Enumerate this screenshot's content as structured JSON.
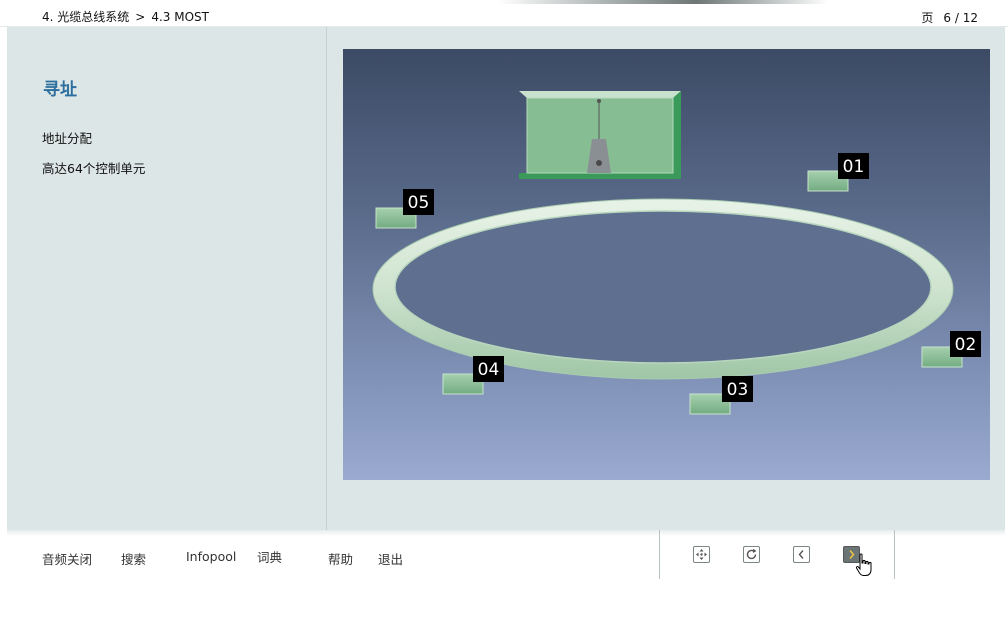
{
  "header": {
    "chapter": "4. 光缆总线系统",
    "separator": ">",
    "section": "4.3 MOST",
    "page_label": "页",
    "page_current": 6,
    "page_total": 12,
    "page_display": "6 / 12"
  },
  "sidebar": {
    "title": "寻址",
    "items": [
      "地址分配",
      "高达64个控制单元"
    ]
  },
  "diagram": {
    "nodes": [
      "01",
      "02",
      "03",
      "04",
      "05"
    ],
    "colors": {
      "ring": "#cfe3cf",
      "node_fill": "#88bd94",
      "label_bg": "#000000",
      "label_text": "#ffffff"
    }
  },
  "footer": {
    "menu": [
      "音频关闭",
      "搜索",
      "Infopool",
      "词典",
      "帮助",
      "退出"
    ],
    "nav_buttons": [
      "overview-icon",
      "reload-icon",
      "previous-icon",
      "next-icon"
    ]
  },
  "colors": {
    "title": "#2d6f9e",
    "panel_bg": "#dde6e6",
    "stage_top": "#3c4a64",
    "stage_bottom": "#9aaad0"
  }
}
